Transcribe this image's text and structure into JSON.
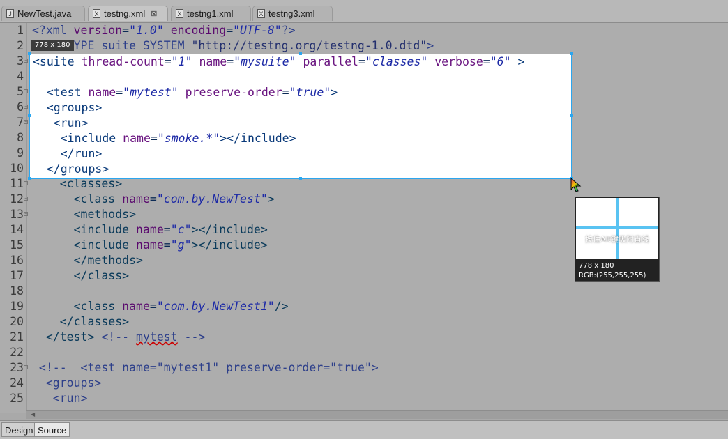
{
  "tabs": [
    {
      "label": "NewTest.java",
      "icon": "java-file-icon",
      "active": false
    },
    {
      "label": "testng.xml",
      "icon": "xml-file-icon",
      "active": true,
      "closable": true
    },
    {
      "label": "testng1.xml",
      "icon": "xml-file-icon",
      "active": false
    },
    {
      "label": "testng3.xml",
      "icon": "xml-file-icon",
      "active": false
    }
  ],
  "editor": {
    "line_numbers": [
      "1",
      "2",
      "3",
      "4",
      "5",
      "6",
      "7",
      "8",
      "9",
      "10",
      "11",
      "12",
      "13",
      "14",
      "15",
      "16",
      "17",
      "18",
      "19",
      "20",
      "21",
      "22",
      "23",
      "24",
      "25"
    ]
  },
  "capture": {
    "size_badge": "778 x 180",
    "magnifier_hint": "按住Alt键吸附直线",
    "magnifier_size": "778 x 180",
    "magnifier_rgb": "RGB:(255,255,255)"
  },
  "bottom_tabs": {
    "design": "Design",
    "source": "Source"
  },
  "colors": {
    "selection_border": "#2ba6ef",
    "crosshair": "#59c3f2"
  }
}
